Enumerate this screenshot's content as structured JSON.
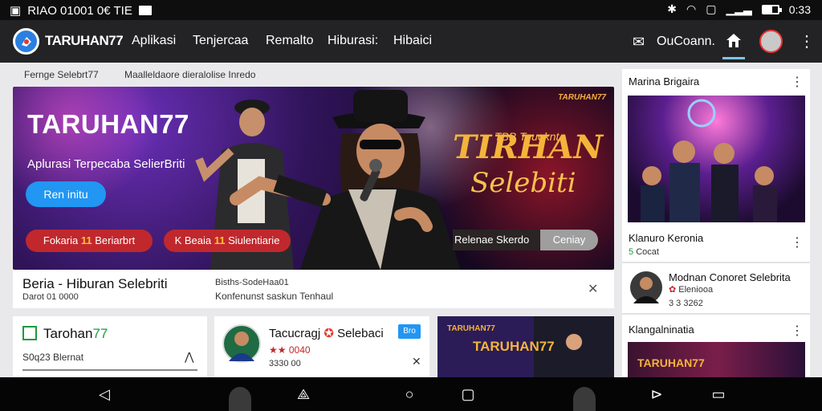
{
  "status_bar": {
    "left_text": "RIAO 01001 0€ TIE",
    "time": "0:33",
    "icons": [
      "photo-icon",
      "mail-icon",
      "bluetooth-icon",
      "wifi-icon",
      "sim-icon",
      "signal-icon",
      "battery-icon"
    ]
  },
  "app_bar": {
    "brand": "TARUHAN77",
    "nav": [
      "Aplikasi",
      "Tenjercaa",
      "Remalto",
      "Hiburasi:",
      "Hibaici"
    ],
    "account_label": "OuCoann.",
    "icons": [
      "logo-icon",
      "mail-icon",
      "home-icon",
      "avatar",
      "kebab-icon"
    ],
    "accent": "#7ec3ff"
  },
  "breadcrumb": {
    "left": "Fernge Selebrt77",
    "right": "Maalleldaore dieralolise Inredo"
  },
  "hero": {
    "title": "TARUHAN77",
    "subtitle": "Aplurasi Terpecaba SelierBriti",
    "cta": "Ren initu",
    "chips": [
      {
        "prefix": "Fokaria",
        "num": "11",
        "suffix": "Beriarbrt"
      },
      {
        "prefix": "K Beaia",
        "num": "11",
        "suffix": "Siulentiarie"
      }
    ],
    "brand_corner": "TARUHAN77",
    "script_top": "TBB Teuoknt",
    "script_mid": "TIRHAN",
    "script_bottom": "Selebiti",
    "release_label": "Relenae Skerdo",
    "release_button": "Ceniay",
    "colors": {
      "chip": "#c0282d",
      "cta": "#2196f3",
      "gold": "#f4b43a"
    }
  },
  "hero_caption": {
    "title": "Beria - Hiburan Selebriti",
    "subtitle": "Darot 01 0000",
    "meta1": "Bisths-SodeHaa01",
    "meta2": "Konfenunst saskun Tenhaul"
  },
  "cards": {
    "card1": {
      "title_a": "Tarohan",
      "title_b": "77",
      "subtitle": "S0q23 Blernat"
    },
    "card2": {
      "title": "Tacucragj",
      "title_suffix": "Selebaci",
      "sub1": "0040",
      "sub2": "3330 00",
      "badge": "Bro"
    },
    "card3": {
      "brand": "TARUHAN77",
      "title": "TARUHAN77"
    }
  },
  "sidebar": {
    "section1_title": "Marina Brigaira",
    "section2_title": "Klanuro Keronia",
    "section2_sub_prefix": "5",
    "section2_sub": "Cocat",
    "item_title": "Modnan Conoret Selebrita",
    "item_sub1_prefix": "✿",
    "item_sub1": "Eleniooa",
    "item_sub2": "3 3 3262",
    "section3_title": "Klangalninatia",
    "img_overlay": "TARUHAN77"
  },
  "nav_bar": {
    "icons": [
      "back-icon",
      "share-icon",
      "home-circle-icon",
      "recents-icon",
      "forward-icon",
      "square-icon"
    ]
  }
}
